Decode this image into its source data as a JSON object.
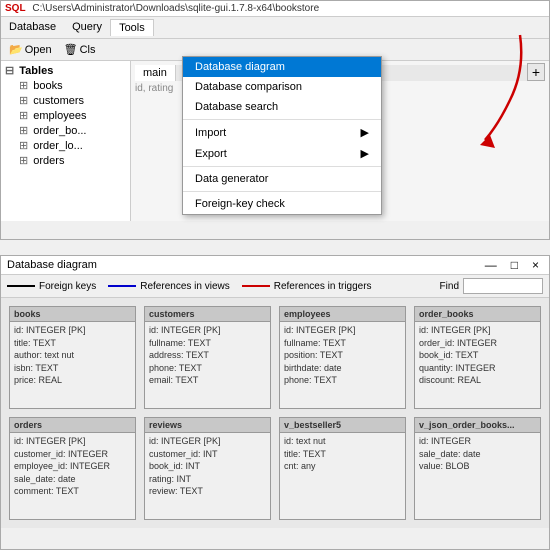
{
  "appWindow": {
    "titleBar": "C:\\Users\\Administrator\\Downloads\\sqlite-gui.1.7.8-x64\\bookstore",
    "sqlLabel": "SQL",
    "menuItems": [
      "Database",
      "Query",
      "Tools"
    ],
    "toolbarItems": [
      "Open",
      "Cls"
    ],
    "tabs": [
      "main"
    ],
    "addButtonLabel": "+",
    "contentHint": "id, rating",
    "treeHeader": "Tables",
    "treeItems": [
      "books",
      "customers",
      "employees",
      "order_bo...",
      "order_lo...",
      "orders"
    ]
  },
  "toolsMenu": {
    "items": [
      {
        "label": "Database diagram",
        "highlighted": true
      },
      {
        "label": "Database comparison"
      },
      {
        "label": "Database search"
      },
      {
        "label": "Import",
        "hasArrow": true
      },
      {
        "label": "Export",
        "hasArrow": true
      },
      {
        "label": "Data generator"
      },
      {
        "label": "Foreign-key check"
      }
    ]
  },
  "diagramWindow": {
    "title": "Database diagram",
    "controls": [
      "—",
      "□",
      "×"
    ],
    "legend": {
      "foreignKeys": "Foreign keys",
      "refsViews": "References in views",
      "refsTriggers": "References in triggers",
      "findLabel": "Find"
    },
    "tables": [
      {
        "name": "books",
        "fields": [
          "id: INTEGER [PK]",
          "title: TEXT",
          "author: text nut",
          "isbn: TEXT",
          "price: REAL"
        ]
      },
      {
        "name": "customers",
        "fields": [
          "id: INTEGER [PK]",
          "fullname: TEXT",
          "address: TEXT",
          "phone: TEXT",
          "email: TEXT"
        ]
      },
      {
        "name": "employees",
        "fields": [
          "id: INTEGER [PK]",
          "fullname: TEXT",
          "position: TEXT",
          "birthdate: date",
          "phone: TEXT"
        ]
      },
      {
        "name": "order_books",
        "fields": [
          "id: INTEGER [PK]",
          "order_id: INTEGER",
          "book_id: TEXT",
          "quantity: INTEGER",
          "discount: REAL"
        ]
      },
      {
        "name": "orders",
        "fields": [
          "id: INTEGER [PK]",
          "customer_id: INTEGER",
          "employee_id: INTEGER",
          "sale_date: date",
          "comment: TEXT"
        ]
      },
      {
        "name": "reviews",
        "fields": [
          "id: INTEGER [PK]",
          "customer_id: INT",
          "book_id: INT",
          "rating: INT",
          "review: TEXT"
        ]
      },
      {
        "name": "v_bestseller5",
        "fields": [
          "id: text nut",
          "title: TEXT",
          "cnt: any"
        ]
      },
      {
        "name": "v_json_order_books...",
        "fields": [
          "id: INTEGER",
          "sale_date: date",
          "value: BLOB"
        ]
      }
    ]
  }
}
